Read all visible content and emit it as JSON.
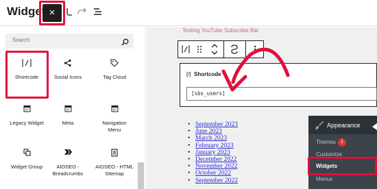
{
  "header": {
    "title": "Widgets",
    "close_glyph": "×",
    "icons": [
      "close-icon",
      "undo-icon",
      "redo-icon",
      "list-view-icon"
    ]
  },
  "inserter": {
    "search_placeholder": "Search",
    "blocks": [
      {
        "label": "Shortcode",
        "icon": "shortcode-icon"
      },
      {
        "label": "Social Icons",
        "icon": "share-icon"
      },
      {
        "label": "Tag Cloud",
        "icon": "tag-icon"
      },
      {
        "label": "Legacy Widget",
        "icon": "calendar-icon"
      },
      {
        "label": "Meta",
        "icon": "calendar-icon"
      },
      {
        "label": "Navigation Menu",
        "icon": "calendar-icon"
      },
      {
        "label": "Widget Group",
        "icon": "group-icon"
      },
      {
        "label": "AIOSEO - Breadcrumbs",
        "icon": "breadcrumbs-icon"
      },
      {
        "label": "AIOSEO - HTML Sitemap",
        "icon": "sitemap-icon"
      }
    ]
  },
  "editor": {
    "sidebar_widget_title": "Testing YouTube Subscribe Bar",
    "block_toolbar_icons": [
      "shortcode-icon",
      "drag-handle-icon",
      "move-up-down-icon",
      "transform-icon",
      "more-options-icon"
    ],
    "shortcode_block": {
      "icon_text": "[/]",
      "title": "Shortcode",
      "value": "[sbs_users]"
    },
    "archives": [
      "September 2023",
      "June 2023",
      "March 2023",
      "February 2023",
      "January 2023",
      "December 2022",
      "November 2022",
      "October 2022",
      "September 2022"
    ]
  },
  "admin_menu": {
    "section": "Appearance",
    "items": [
      "Themes",
      "Customize",
      "Widgets",
      "Menus"
    ],
    "themes_badge": "1",
    "active_item": "Widgets"
  },
  "colors": {
    "highlight": "#e0103a",
    "admin_bg": "#2c3338",
    "link": "#2b2bd6"
  }
}
